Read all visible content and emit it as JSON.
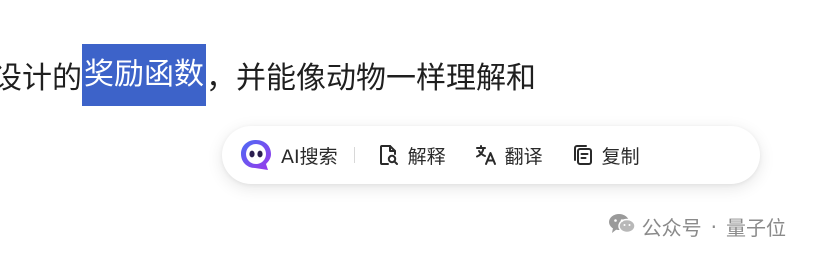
{
  "article": {
    "before": "设计的",
    "selected": "奖励函数",
    "after": "，并能像动物一样理解和"
  },
  "toolbar": {
    "ai_search": "AI搜索",
    "explain": "解释",
    "translate": "翻译",
    "copy": "复制"
  },
  "watermark": {
    "account_type": "公众号",
    "separator": "·",
    "account_name": "量子位"
  },
  "colors": {
    "selection": "#3d63c9",
    "ai_logo": "#7b3ff2"
  }
}
